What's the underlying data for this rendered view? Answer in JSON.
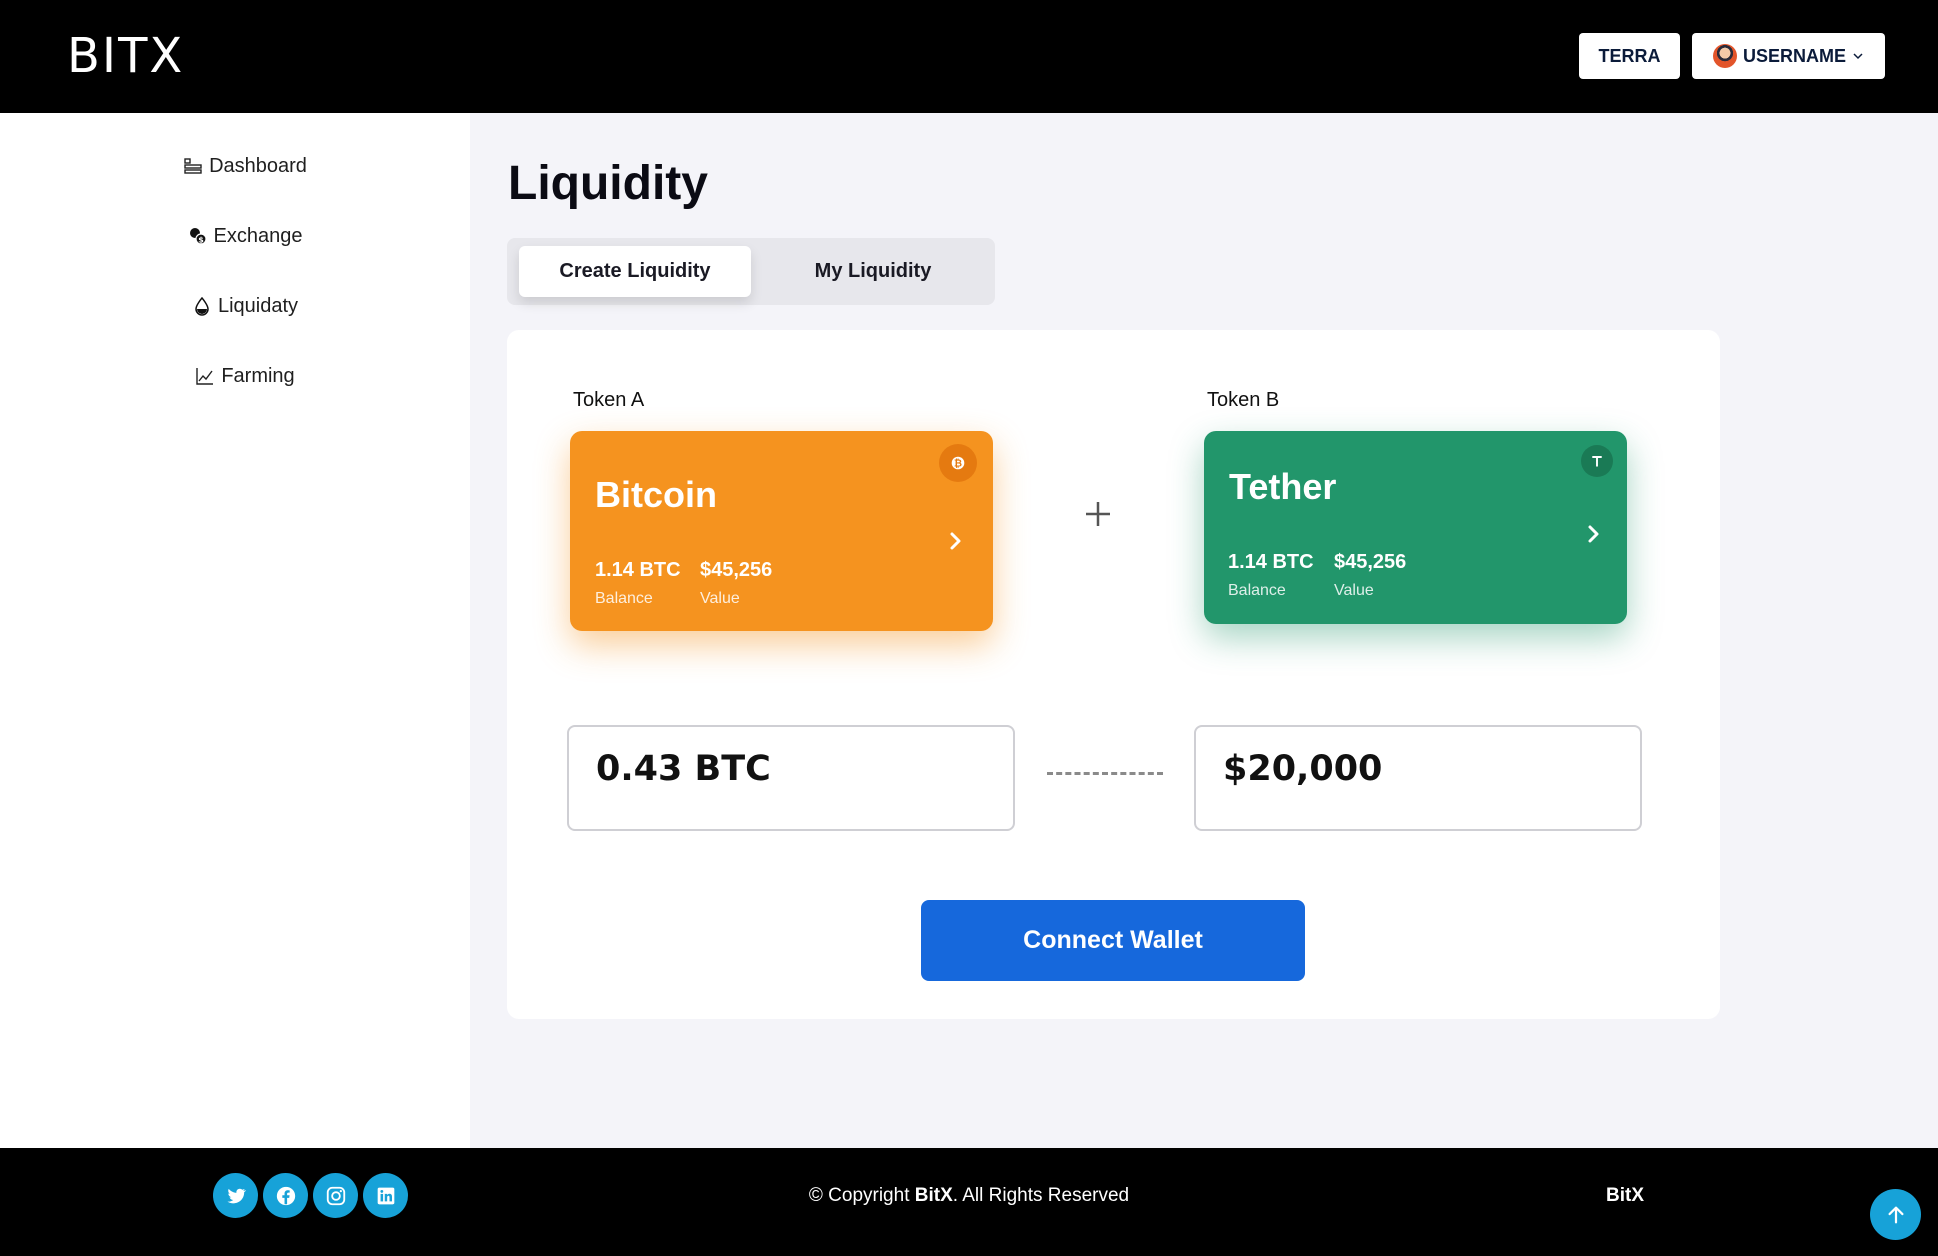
{
  "header": {
    "logo": "BITX",
    "network_label": "TERRA",
    "user_label": "USERNAME"
  },
  "sidebar": {
    "items": [
      {
        "label": "Dashboard",
        "icon": "dashboard-icon"
      },
      {
        "label": "Exchange",
        "icon": "exchange-icon"
      },
      {
        "label": "Liquidaty",
        "icon": "droplet-icon"
      },
      {
        "label": "Farming",
        "icon": "chart-line-icon"
      }
    ]
  },
  "main": {
    "title": "Liquidity",
    "tabs": [
      {
        "label": "Create Liquidity",
        "active": true
      },
      {
        "label": "My Liquidity",
        "active": false
      }
    ],
    "token_a": {
      "section_label": "Token A",
      "name": "Bitcoin",
      "balance": "1.14 BTC",
      "balance_label": "Balance",
      "value": "$45,256",
      "value_label": "Value",
      "color": "#f5931f",
      "icon": "bitcoin-icon"
    },
    "token_b": {
      "section_label": "Token B",
      "name": "Tether",
      "balance": "1.14 BTC",
      "balance_label": "Balance",
      "value": "$45,256",
      "value_label": "Value",
      "color": "#22966b",
      "icon": "tether-icon"
    },
    "amount_a": "0.43 BTC",
    "amount_b": "$20,000",
    "connect_label": "Connect Wallet"
  },
  "footer": {
    "social": [
      "twitter-icon",
      "facebook-icon",
      "instagram-icon",
      "linkedin-icon"
    ],
    "copyright_prefix": "© Copyright ",
    "copyright_brand": "BitX",
    "copyright_suffix": ". All Rights Reserved",
    "brand": "BitX"
  },
  "colors": {
    "accent": "#1668dc",
    "social": "#17a2d8"
  }
}
